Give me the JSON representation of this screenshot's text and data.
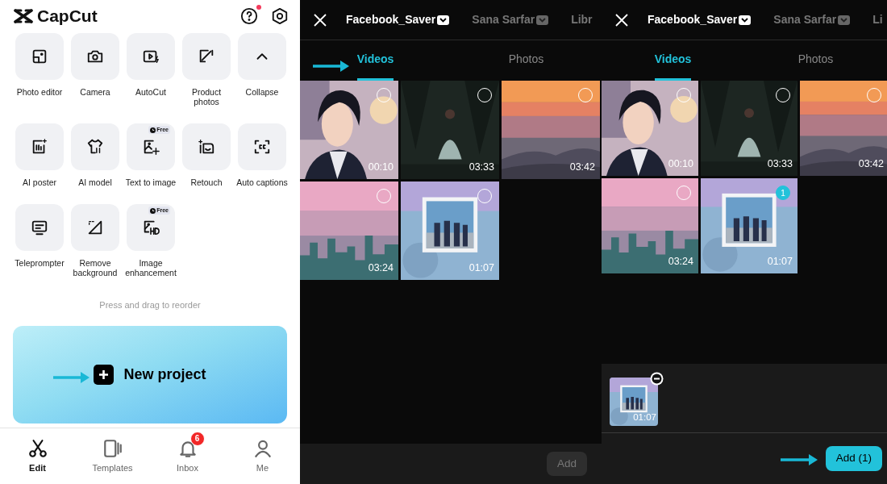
{
  "home": {
    "app_name": "CapCut",
    "help_alert": true,
    "tools": [
      {
        "label": "Photo editor"
      },
      {
        "label": "Camera"
      },
      {
        "label": "AutoCut"
      },
      {
        "label": "Product photos"
      },
      {
        "label": "Collapse"
      },
      {
        "label": "AI poster"
      },
      {
        "label": "AI model"
      },
      {
        "label": "Text to image",
        "badge": "Free"
      },
      {
        "label": "Retouch"
      },
      {
        "label": "Auto captions"
      },
      {
        "label": "Teleprompter"
      },
      {
        "label": "Remove background"
      },
      {
        "label": "Image enhancement",
        "badge": "Free"
      }
    ],
    "hint": "Press and drag to reorder",
    "new_project": "New project",
    "nav": [
      {
        "label": "Edit",
        "selected": true
      },
      {
        "label": "Templates",
        "selected": false
      },
      {
        "label": "Inbox",
        "selected": false,
        "badge": "6"
      },
      {
        "label": "Me",
        "selected": false
      }
    ]
  },
  "pickers": [
    {
      "albums": [
        {
          "label": "Facebook_Saver",
          "selected": true,
          "dropdown": true
        },
        {
          "label": "Sana Sarfar",
          "selected": false,
          "dropdown": true
        },
        {
          "label": "Libr",
          "selected": false,
          "dropdown": false
        }
      ],
      "tabs": [
        {
          "label": "Videos",
          "selected": true
        },
        {
          "label": "Photos",
          "selected": false
        }
      ],
      "videos": [
        {
          "duration": "00:10",
          "selected": false
        },
        {
          "duration": "03:33",
          "selected": false
        },
        {
          "duration": "03:42",
          "selected": false
        },
        {
          "duration": "03:24",
          "selected": false
        },
        {
          "duration": "01:07",
          "selected": false
        }
      ],
      "add_button": {
        "label": "Add",
        "enabled": false
      }
    },
    {
      "albums": [
        {
          "label": "Facebook_Saver",
          "selected": true,
          "dropdown": true
        },
        {
          "label": "Sana Sarfar",
          "selected": false,
          "dropdown": true
        },
        {
          "label": "Li",
          "selected": false,
          "dropdown": false
        }
      ],
      "tabs": [
        {
          "label": "Videos",
          "selected": true
        },
        {
          "label": "Photos",
          "selected": false
        }
      ],
      "videos": [
        {
          "duration": "00:10",
          "selected": false
        },
        {
          "duration": "03:33",
          "selected": false
        },
        {
          "duration": "03:42",
          "selected": false
        },
        {
          "duration": "03:24",
          "selected": false
        },
        {
          "duration": "01:07",
          "selected": true,
          "order": "1"
        }
      ],
      "tray": [
        {
          "duration": "01:07"
        }
      ],
      "add_button": {
        "label": "Add (1)",
        "enabled": true
      }
    }
  ]
}
